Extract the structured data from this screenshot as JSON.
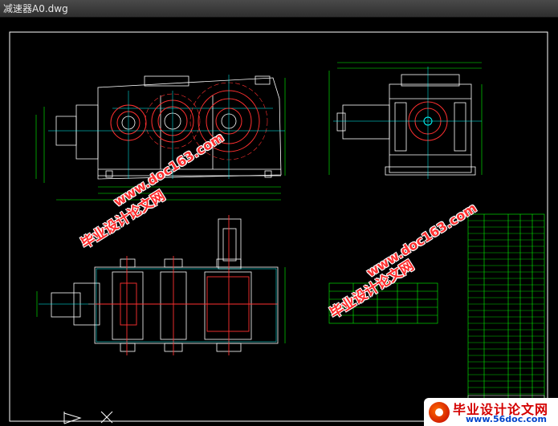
{
  "window": {
    "title": "减速器A0.dwg"
  },
  "watermarks": [
    {
      "text": "毕业设计论文网"
    },
    {
      "text": "www.doc163.com"
    }
  ],
  "logo": {
    "cn": "毕业设计论文网",
    "url": "www.56doc.com"
  },
  "icons": {
    "ucs": "ucs-icon",
    "arrow": "ucs-arrow-icon"
  },
  "colors": {
    "background": "#000000",
    "cad_white": "#ffffff",
    "cad_red": "#ff3030",
    "cad_cyan": "#00ffff",
    "cad_green": "#00ff00",
    "cad_yellow": "#ffff00"
  }
}
